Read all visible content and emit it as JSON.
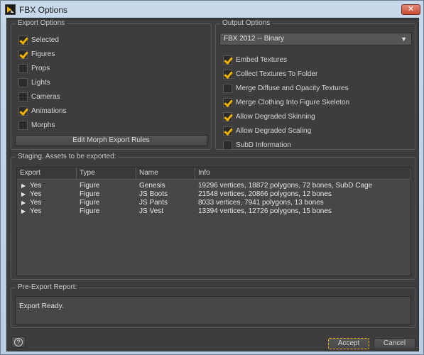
{
  "window": {
    "title": "FBX Options",
    "close": "✕"
  },
  "export_options": {
    "title": "Export Options",
    "items": [
      {
        "label": "Selected",
        "checked": true
      },
      {
        "label": "Figures",
        "checked": true
      },
      {
        "label": "Props",
        "checked": false
      },
      {
        "label": "Lights",
        "checked": false
      },
      {
        "label": "Cameras",
        "checked": false
      },
      {
        "label": "Animations",
        "checked": true
      },
      {
        "label": "Morphs",
        "checked": false
      }
    ],
    "edit_morph_button": "Edit Morph Export Rules"
  },
  "output_options": {
    "title": "Output Options",
    "format": {
      "selected": "FBX 2012 -- Binary",
      "arrow": "▼"
    },
    "items": [
      {
        "label": "Embed Textures",
        "checked": true
      },
      {
        "label": "Collect Textures To Folder",
        "checked": true
      },
      {
        "label": "Merge Diffuse and Opacity Textures",
        "checked": false
      },
      {
        "label": "Merge Clothing Into Figure Skeleton",
        "checked": true
      },
      {
        "label": "Allow Degraded Skinning",
        "checked": true
      },
      {
        "label": "Allow Degraded Scaling",
        "checked": true
      },
      {
        "label": "SubD Information",
        "checked": false
      }
    ]
  },
  "staging": {
    "title": "Staging. Assets to be exported:",
    "columns": [
      "Export",
      "Type",
      "Name",
      "Info"
    ],
    "rows": [
      {
        "export": "Yes",
        "type": "Figure",
        "name": "Genesis",
        "info": "19296 vertices, 18872 polygons, 72 bones, SubD Cage"
      },
      {
        "export": "Yes",
        "type": "Figure",
        "name": "JS Boots",
        "info": "21548 vertices, 20866 polygons, 12 bones"
      },
      {
        "export": "Yes",
        "type": "Figure",
        "name": "JS Pants",
        "info": "8033 vertices, 7941 polygons, 13 bones"
      },
      {
        "export": "Yes",
        "type": "Figure",
        "name": "JS Vest",
        "info": "13394 vertices, 12726 polygons, 15 bones"
      }
    ]
  },
  "report": {
    "title": "Pre-Export Report:",
    "text": "Export Ready."
  },
  "footer": {
    "help": "?",
    "accept": "Accept",
    "cancel": "Cancel"
  },
  "colors": {
    "accent": "#f0b400",
    "panel": "#3d3d3d",
    "titlebar": "#c7d8ea"
  }
}
